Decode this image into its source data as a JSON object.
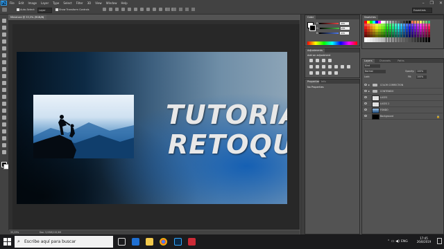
{
  "app": {
    "logo": "Ps"
  },
  "menu": [
    "File",
    "Edit",
    "Image",
    "Layer",
    "Type",
    "Select",
    "Filter",
    "3D",
    "View",
    "Window",
    "Help"
  ],
  "window_controls": {
    "minimize": "–",
    "restore": "❐",
    "close": "✕"
  },
  "workspace": {
    "value": "Essentials"
  },
  "options": {
    "auto_select_label": "Auto-Select:",
    "auto_select_value": "Layer",
    "transform_label": "Show Transform Controls"
  },
  "document": {
    "tab_label": "Miniatura @ 33,3% (RGB/8)",
    "close": "×"
  },
  "canvas": {
    "title_line1": "TUTORIAL",
    "title_line2": "RETOQUE"
  },
  "status": {
    "zoom": "33,33%",
    "doc_info": "Doc: 5,93M/115,9M"
  },
  "color_panel": {
    "tab": "Color",
    "sliders": [
      {
        "label": "R",
        "value": "255",
        "gradient": "#e84545"
      },
      {
        "label": "G",
        "value": "255",
        "gradient": "#48c248"
      },
      {
        "label": "B",
        "value": "255",
        "gradient": "#4f79ea"
      }
    ]
  },
  "swatches_panel": {
    "tab": "Swatches"
  },
  "adjustments_panel": {
    "tab": "Adjustments",
    "heading": "Add an adjustment"
  },
  "properties_panel": {
    "tab1": "Properties",
    "tab2": "Info",
    "text": "No Properties"
  },
  "layers_panel": {
    "tabs": [
      "Layers",
      "Channels",
      "Paths"
    ],
    "kind": "Kind",
    "blend": "Normal",
    "opacity_label": "Opacity:",
    "opacity": "100%",
    "lock_label": "Lock:",
    "fill_label": "Fill:",
    "fill": "100%",
    "layers": [
      {
        "name": "COLOR CORRECTION",
        "type": "group"
      },
      {
        "name": "CONTENIDO",
        "type": "group"
      },
      {
        "name": "LUCES",
        "type": "smart"
      },
      {
        "name": "LUCES 2",
        "type": "smart"
      },
      {
        "name": "FONDO",
        "type": "image"
      },
      {
        "name": "Background",
        "type": "background"
      }
    ]
  },
  "taskbar": {
    "search_placeholder": "Escribe aquí para buscar",
    "lang": "ENG",
    "time": "17:45",
    "date": "26/8/2019"
  }
}
